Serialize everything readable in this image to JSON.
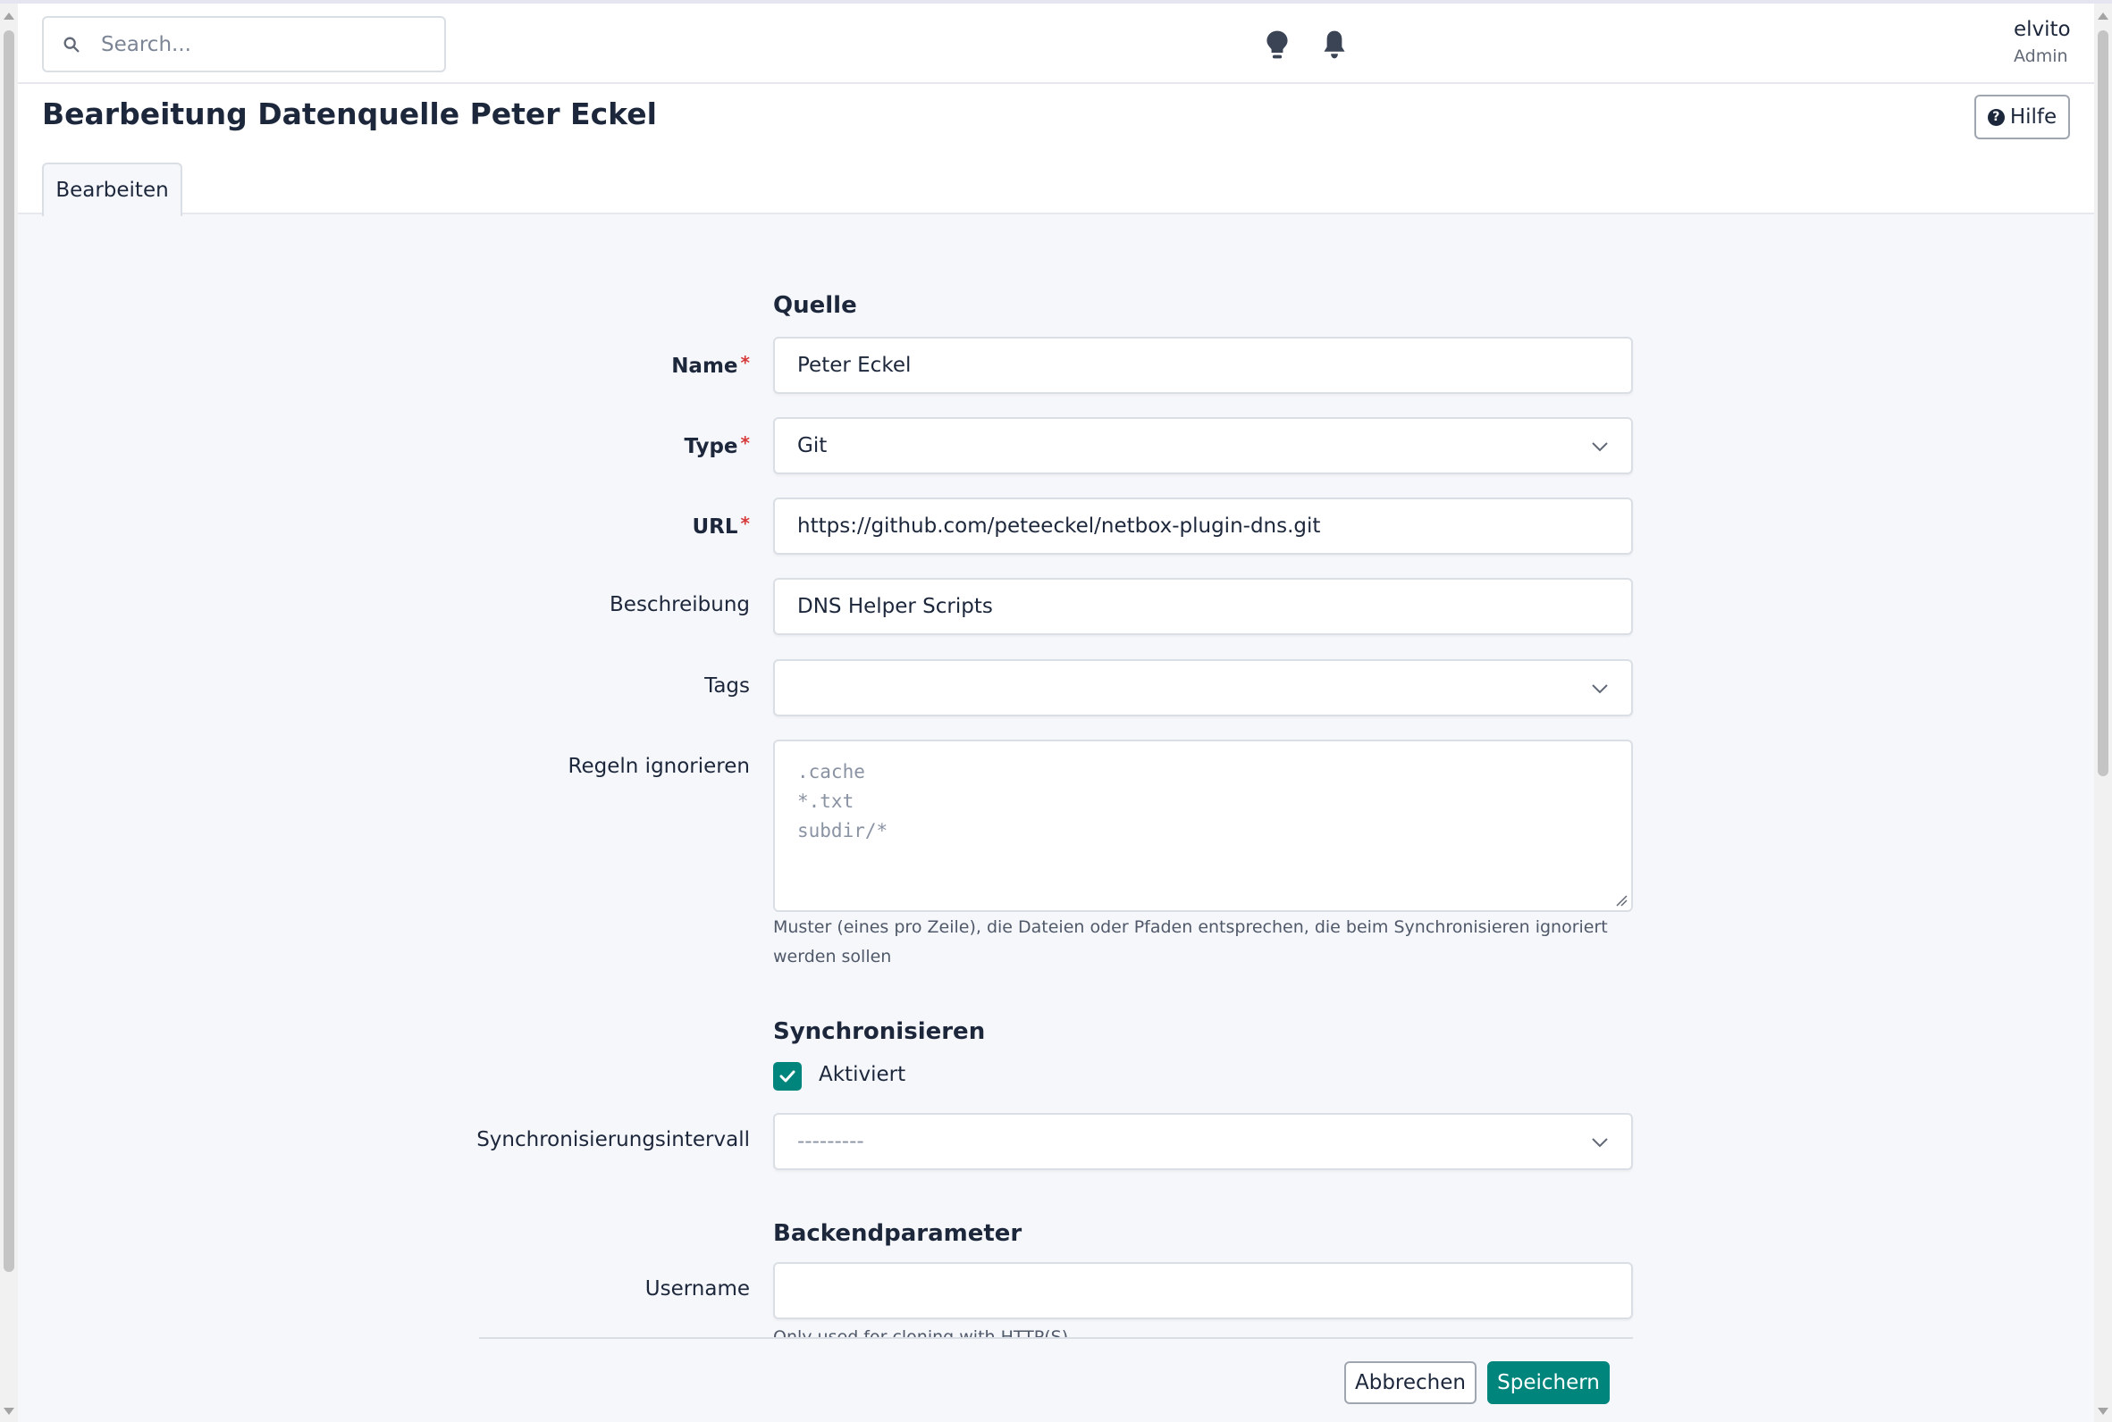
{
  "header": {
    "search_placeholder": "Search...",
    "icons": [
      "search-icon",
      "lightbulb-icon",
      "bell-icon"
    ],
    "user": {
      "name": "elvito",
      "role": "Admin"
    }
  },
  "page": {
    "title": "Bearbeitung Datenquelle Peter Eckel",
    "help_label": "Hilfe",
    "tab_label": "Bearbeiten"
  },
  "form": {
    "section_source": "Quelle",
    "name": {
      "label": "Name",
      "required": "*",
      "value": "Peter Eckel"
    },
    "type": {
      "label": "Type",
      "required": "*",
      "value": "Git"
    },
    "url": {
      "label": "URL",
      "required": "*",
      "value": "https://github.com/peteeckel/netbox-plugin-dns.git"
    },
    "description": {
      "label": "Beschreibung",
      "value": "DNS Helper Scripts"
    },
    "tags": {
      "label": "Tags",
      "value": ""
    },
    "ignore_rules": {
      "label": "Regeln ignorieren",
      "placeholder_lines": [
        ".cache",
        "*.txt",
        "subdir/*"
      ],
      "help": "Muster (eines pro Zeile), die Dateien oder Pfaden entsprechen, die beim Synchronisieren ignoriert werden sollen"
    },
    "section_sync": "Synchronisieren",
    "enabled": {
      "label": "Aktiviert",
      "checked": true
    },
    "sync_interval": {
      "label": "Synchronisierungsintervall",
      "value": "---------"
    },
    "section_backend": "Backendparameter",
    "username": {
      "label": "Username",
      "value": "",
      "help": "Only used for cloning with HTTP(S)"
    }
  },
  "actions": {
    "cancel": "Abbrechen",
    "save": "Speichern"
  },
  "colors": {
    "primary": "#00857d",
    "required": "#d63939",
    "text": "#1d273b"
  }
}
